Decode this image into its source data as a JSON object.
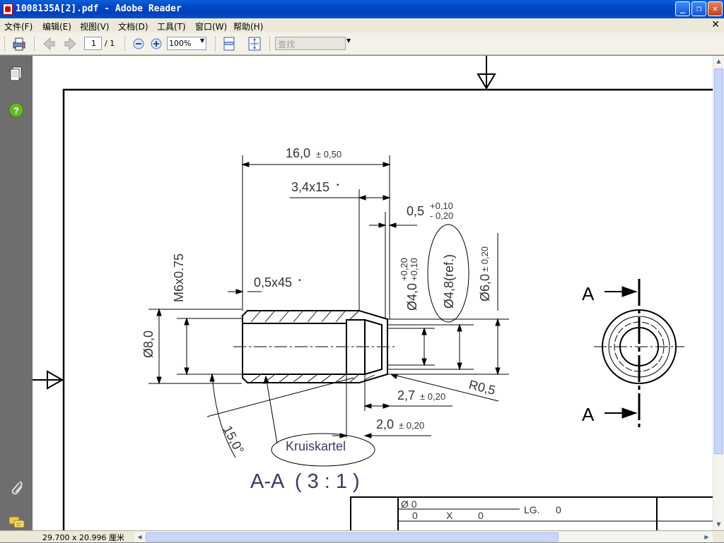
{
  "window": {
    "title": "1008135A[2].pdf - Adobe Reader",
    "min": "_",
    "max": "❐",
    "close": "✕"
  },
  "menu": [
    "文件(F)",
    "编辑(E)",
    "视图(V)",
    "文档(D)",
    "工具(T)",
    "窗口(W)",
    "帮助(H)"
  ],
  "menu_close": "✕",
  "toolbar": {
    "page_current": "1",
    "page_total": "/ 1",
    "zoom": "100%",
    "find_placeholder": "查找"
  },
  "status": {
    "page_size": "29.700 x 20.996 厘米"
  },
  "drawing": {
    "dim_length": "16,0",
    "dim_length_tol": "± 0,50",
    "dim_chamfer_top": "3,4x15",
    "dim_chamfer_top_deg": "•",
    "dim_groove": "0,5",
    "dim_groove_tol_plus": "+0,10",
    "dim_groove_tol_minus": "- 0,20",
    "dim_thread": "M6x0.75",
    "dim_chamfer_left": "0,5x45",
    "dim_chamfer_left_deg": "•",
    "dim_od": "Ø8,0",
    "dim_bore": "Ø4,0",
    "dim_bore_tol_plus": "+0,20",
    "dim_bore_tol_minus": "+0,10",
    "dim_ref": "Ø4,8(ref.)",
    "dim_dia6": "Ø6,0",
    "dim_dia6_tol": "± 0,20",
    "dim_radius": "R0,5",
    "dim_depth1": "2,7",
    "dim_depth1_tol": "± 0,20",
    "dim_depth2": "2,0",
    "dim_depth2_tol": "± 0,20",
    "dim_angle": "15,0°",
    "note_knurl": "Kruiskartel",
    "section_title": "A-A  ( 3 : 1 )",
    "section_mark_top": "A",
    "section_mark_bottom": "A",
    "titleblock": {
      "dia": "Ø 0",
      "row_a": "0",
      "row_x": "X",
      "row_b": "0",
      "lg_label": "LG.",
      "lg_value": "0"
    }
  }
}
